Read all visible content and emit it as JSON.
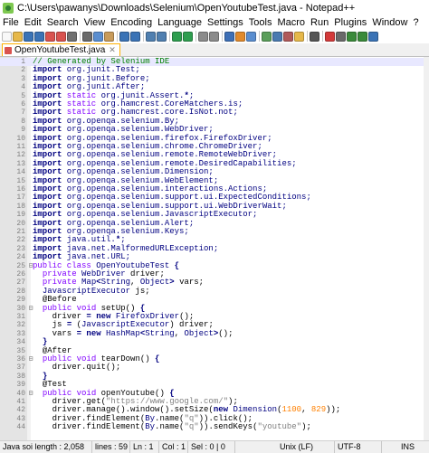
{
  "window": {
    "title": "C:\\Users\\pawanys\\Downloads\\Selenium\\OpenYoutubeTest.java - Notepad++"
  },
  "menu": [
    "File",
    "Edit",
    "Search",
    "View",
    "Encoding",
    "Language",
    "Settings",
    "Tools",
    "Macro",
    "Run",
    "Plugins",
    "Window",
    "?"
  ],
  "toolbar": {
    "buttons": [
      {
        "icon": "new-file-icon",
        "color": "#f8f8f8"
      },
      {
        "icon": "open-file-icon",
        "color": "#e6b84a"
      },
      {
        "icon": "save-icon",
        "color": "#3a73b6"
      },
      {
        "icon": "save-all-icon",
        "color": "#3a73b6"
      },
      {
        "icon": "close-icon",
        "color": "#d9534f"
      },
      {
        "icon": "close-all-icon",
        "color": "#d9534f"
      },
      {
        "icon": "print-icon",
        "color": "#707070"
      },
      {
        "sep": true
      },
      {
        "icon": "cut-icon",
        "color": "#6a6a6a"
      },
      {
        "icon": "copy-icon",
        "color": "#5a8ed0"
      },
      {
        "icon": "paste-icon",
        "color": "#c89b5a"
      },
      {
        "sep": true
      },
      {
        "icon": "undo-icon",
        "color": "#3a73b6"
      },
      {
        "icon": "redo-icon",
        "color": "#3a73b6"
      },
      {
        "sep": true
      },
      {
        "icon": "find-icon",
        "color": "#4f7fb0"
      },
      {
        "icon": "replace-icon",
        "color": "#4f7fb0"
      },
      {
        "sep": true
      },
      {
        "icon": "zoom-in-icon",
        "color": "#2e9e4f"
      },
      {
        "icon": "zoom-out-icon",
        "color": "#2e9e4f"
      },
      {
        "sep": true
      },
      {
        "icon": "sync-vertical-icon",
        "color": "#8b8b8b"
      },
      {
        "icon": "sync-horizontal-icon",
        "color": "#8b8b8b"
      },
      {
        "sep": true
      },
      {
        "icon": "word-wrap-icon",
        "color": "#3d6fb6"
      },
      {
        "icon": "show-all-chars-icon",
        "color": "#e08a2c"
      },
      {
        "icon": "indent-guide-icon",
        "color": "#5a8ed0"
      },
      {
        "sep": true
      },
      {
        "icon": "user-lang-icon",
        "color": "#5a9e5a"
      },
      {
        "icon": "doc-map-icon",
        "color": "#4a7ab0"
      },
      {
        "icon": "function-list-icon",
        "color": "#b05a5a"
      },
      {
        "icon": "folder-workspace-icon",
        "color": "#e6b84a"
      },
      {
        "sep": true
      },
      {
        "icon": "monitoring-icon",
        "color": "#555555"
      },
      {
        "sep": true
      },
      {
        "icon": "record-macro-icon",
        "color": "#d33a3a"
      },
      {
        "icon": "stop-record-icon",
        "color": "#6a6a6a"
      },
      {
        "icon": "play-macro-icon",
        "color": "#3a8a3a"
      },
      {
        "icon": "play-multiple-icon",
        "color": "#3a8a3a"
      },
      {
        "icon": "save-macro-icon",
        "color": "#3a73b6"
      }
    ]
  },
  "tab": {
    "label": "OpenYoutubeTest.java",
    "close": "✕"
  },
  "code": [
    {
      "n": "1",
      "fold": "",
      "segs": [
        [
          "cmt",
          "// Generated by Selenium IDE"
        ]
      ]
    },
    {
      "n": "2",
      "fold": "",
      "segs": [
        [
          "kw",
          "import"
        ],
        [
          "id",
          " org.junit.Test;"
        ]
      ]
    },
    {
      "n": "3",
      "fold": "",
      "segs": [
        [
          "kw",
          "import"
        ],
        [
          "id",
          " org.junit.Before;"
        ]
      ]
    },
    {
      "n": "4",
      "fold": "",
      "segs": [
        [
          "kw",
          "import"
        ],
        [
          "id",
          " org.junit.After;"
        ]
      ]
    },
    {
      "n": "5",
      "fold": "",
      "segs": [
        [
          "kw",
          "import"
        ],
        [
          "kw2",
          " static"
        ],
        [
          "id",
          " org.junit.Assert."
        ],
        [
          "op",
          "*"
        ],
        [
          "id",
          ";"
        ]
      ]
    },
    {
      "n": "6",
      "fold": "",
      "segs": [
        [
          "kw",
          "import"
        ],
        [
          "kw2",
          " static"
        ],
        [
          "id",
          " org.hamcrest.CoreMatchers.is;"
        ]
      ]
    },
    {
      "n": "7",
      "fold": "",
      "segs": [
        [
          "kw",
          "import"
        ],
        [
          "kw2",
          " static"
        ],
        [
          "id",
          " org.hamcrest.core.IsNot.not;"
        ]
      ]
    },
    {
      "n": "8",
      "fold": "",
      "segs": [
        [
          "kw",
          "import"
        ],
        [
          "id",
          " org.openqa.selenium.By;"
        ]
      ]
    },
    {
      "n": "9",
      "fold": "",
      "segs": [
        [
          "kw",
          "import"
        ],
        [
          "id",
          " org.openqa.selenium.WebDriver;"
        ]
      ]
    },
    {
      "n": "10",
      "fold": "",
      "segs": [
        [
          "kw",
          "import"
        ],
        [
          "id",
          " org.openqa.selenium.firefox.FirefoxDriver;"
        ]
      ]
    },
    {
      "n": "11",
      "fold": "",
      "segs": [
        [
          "kw",
          "import"
        ],
        [
          "id",
          " org.openqa.selenium.chrome.ChromeDriver;"
        ]
      ]
    },
    {
      "n": "12",
      "fold": "",
      "segs": [
        [
          "kw",
          "import"
        ],
        [
          "id",
          " org.openqa.selenium.remote.RemoteWebDriver;"
        ]
      ]
    },
    {
      "n": "13",
      "fold": "",
      "segs": [
        [
          "kw",
          "import"
        ],
        [
          "id",
          " org.openqa.selenium.remote.DesiredCapabilities;"
        ]
      ]
    },
    {
      "n": "14",
      "fold": "",
      "segs": [
        [
          "kw",
          "import"
        ],
        [
          "id",
          " org.openqa.selenium.Dimension;"
        ]
      ]
    },
    {
      "n": "15",
      "fold": "",
      "segs": [
        [
          "kw",
          "import"
        ],
        [
          "id",
          " org.openqa.selenium.WebElement;"
        ]
      ]
    },
    {
      "n": "16",
      "fold": "",
      "segs": [
        [
          "kw",
          "import"
        ],
        [
          "id",
          " org.openqa.selenium.interactions.Actions;"
        ]
      ]
    },
    {
      "n": "17",
      "fold": "",
      "segs": [
        [
          "kw",
          "import"
        ],
        [
          "id",
          " org.openqa.selenium.support.ui.ExpectedConditions;"
        ]
      ]
    },
    {
      "n": "18",
      "fold": "",
      "segs": [
        [
          "kw",
          "import"
        ],
        [
          "id",
          " org.openqa.selenium.support.ui.WebDriverWait;"
        ]
      ]
    },
    {
      "n": "19",
      "fold": "",
      "segs": [
        [
          "kw",
          "import"
        ],
        [
          "id",
          " org.openqa.selenium.JavascriptExecutor;"
        ]
      ]
    },
    {
      "n": "20",
      "fold": "",
      "segs": [
        [
          "kw",
          "import"
        ],
        [
          "id",
          " org.openqa.selenium.Alert;"
        ]
      ]
    },
    {
      "n": "21",
      "fold": "",
      "segs": [
        [
          "kw",
          "import"
        ],
        [
          "id",
          " org.openqa.selenium.Keys;"
        ]
      ]
    },
    {
      "n": "22",
      "fold": "",
      "segs": [
        [
          "kw",
          "import"
        ],
        [
          "id",
          " java.util."
        ],
        [
          "op",
          "*"
        ],
        [
          "id",
          ";"
        ]
      ]
    },
    {
      "n": "23",
      "fold": "",
      "segs": [
        [
          "kw",
          "import"
        ],
        [
          "id",
          " java.net.MalformedURLException;"
        ]
      ]
    },
    {
      "n": "24",
      "fold": "",
      "segs": [
        [
          "kw",
          "import"
        ],
        [
          "id",
          " java.net.URL;"
        ]
      ]
    },
    {
      "n": "25",
      "fold": "⊟",
      "segs": [
        [
          "kw2",
          "public"
        ],
        [
          "kw2",
          " class"
        ],
        [
          "cls",
          " OpenYoutubeTest "
        ],
        [
          "op",
          "{"
        ]
      ]
    },
    {
      "n": "26",
      "fold": "",
      "segs": [
        [
          "plain",
          "  "
        ],
        [
          "kw2",
          "private"
        ],
        [
          "cls",
          " WebDriver"
        ],
        [
          "plain",
          " driver;"
        ]
      ]
    },
    {
      "n": "27",
      "fold": "",
      "segs": [
        [
          "plain",
          "  "
        ],
        [
          "kw2",
          "private"
        ],
        [
          "cls",
          " Map"
        ],
        [
          "op",
          "<"
        ],
        [
          "cls",
          "String"
        ],
        [
          "plain",
          ", "
        ],
        [
          "cls",
          "Object"
        ],
        [
          "op",
          ">"
        ],
        [
          "plain",
          " vars;"
        ]
      ]
    },
    {
      "n": "28",
      "fold": "",
      "segs": [
        [
          "plain",
          "  "
        ],
        [
          "cls",
          "JavascriptExecutor"
        ],
        [
          "plain",
          " js;"
        ]
      ]
    },
    {
      "n": "29",
      "fold": "",
      "segs": [
        [
          "plain",
          "  "
        ],
        [
          "anno",
          "@Before"
        ]
      ]
    },
    {
      "n": "30",
      "fold": "⊟",
      "segs": [
        [
          "plain",
          "  "
        ],
        [
          "kw2",
          "public"
        ],
        [
          "kw2",
          " void"
        ],
        [
          "plain",
          " setUp() "
        ],
        [
          "op",
          "{"
        ]
      ]
    },
    {
      "n": "31",
      "fold": "",
      "segs": [
        [
          "plain",
          "    driver "
        ],
        [
          "op",
          "="
        ],
        [
          "kw",
          " new"
        ],
        [
          "cls",
          " FirefoxDriver"
        ],
        [
          "plain",
          "();"
        ]
      ]
    },
    {
      "n": "32",
      "fold": "",
      "segs": [
        [
          "plain",
          "    js "
        ],
        [
          "op",
          "="
        ],
        [
          "plain",
          " ("
        ],
        [
          "cls",
          "JavascriptExecutor"
        ],
        [
          "plain",
          ") driver;"
        ]
      ]
    },
    {
      "n": "33",
      "fold": "",
      "segs": [
        [
          "plain",
          "    vars "
        ],
        [
          "op",
          "="
        ],
        [
          "kw",
          " new"
        ],
        [
          "cls",
          " HashMap"
        ],
        [
          "op",
          "<"
        ],
        [
          "cls",
          "String"
        ],
        [
          "plain",
          ", "
        ],
        [
          "cls",
          "Object"
        ],
        [
          "op",
          ">"
        ],
        [
          "plain",
          "();"
        ]
      ]
    },
    {
      "n": "34",
      "fold": "",
      "segs": [
        [
          "plain",
          "  "
        ],
        [
          "op",
          "}"
        ]
      ]
    },
    {
      "n": "35",
      "fold": "",
      "segs": [
        [
          "plain",
          "  "
        ],
        [
          "anno",
          "@After"
        ]
      ]
    },
    {
      "n": "36",
      "fold": "⊟",
      "segs": [
        [
          "plain",
          "  "
        ],
        [
          "kw2",
          "public"
        ],
        [
          "kw2",
          " void"
        ],
        [
          "plain",
          " tearDown() "
        ],
        [
          "op",
          "{"
        ]
      ]
    },
    {
      "n": "37",
      "fold": "",
      "segs": [
        [
          "plain",
          "    driver.quit();"
        ]
      ]
    },
    {
      "n": "38",
      "fold": "",
      "segs": [
        [
          "plain",
          "  "
        ],
        [
          "op",
          "}"
        ]
      ]
    },
    {
      "n": "39",
      "fold": "",
      "segs": [
        [
          "plain",
          "  "
        ],
        [
          "anno",
          "@Test"
        ]
      ]
    },
    {
      "n": "40",
      "fold": "⊟",
      "segs": [
        [
          "plain",
          "  "
        ],
        [
          "kw2",
          "public"
        ],
        [
          "kw2",
          " void"
        ],
        [
          "plain",
          " openYoutube() "
        ],
        [
          "op",
          "{"
        ]
      ]
    },
    {
      "n": "41",
      "fold": "",
      "segs": [
        [
          "plain",
          "    driver.get("
        ],
        [
          "str",
          "\"https://www.google.com/\""
        ],
        [
          "plain",
          ");"
        ]
      ]
    },
    {
      "n": "42",
      "fold": "",
      "segs": [
        [
          "plain",
          "    driver.manage().window().setSize("
        ],
        [
          "kw",
          "new"
        ],
        [
          "cls",
          " Dimension"
        ],
        [
          "plain",
          "("
        ],
        [
          "num",
          "1100"
        ],
        [
          "plain",
          ", "
        ],
        [
          "num",
          "829"
        ],
        [
          "plain",
          "));"
        ]
      ]
    },
    {
      "n": "43",
      "fold": "",
      "segs": [
        [
          "plain",
          "    driver.findElement("
        ],
        [
          "cls",
          "By"
        ],
        [
          "plain",
          ".name("
        ],
        [
          "str",
          "\"q\""
        ],
        [
          "plain",
          ")).click();"
        ]
      ]
    },
    {
      "n": "44",
      "fold": "",
      "segs": [
        [
          "plain",
          "    driver.findElement("
        ],
        [
          "cls",
          "By"
        ],
        [
          "plain",
          ".name("
        ],
        [
          "str",
          "\"q\""
        ],
        [
          "plain",
          ")).sendKeys("
        ],
        [
          "str",
          "\"youtube\""
        ],
        [
          "plain",
          ");"
        ]
      ]
    }
  ],
  "status": {
    "length": "Java soi length : 2,058",
    "lines": "lines : 59",
    "ln": "Ln : 1",
    "col": "Col : 1",
    "sel": "Sel : 0 | 0",
    "eol": "Unix (LF)",
    "encoding": "UTF-8",
    "mode": "INS"
  },
  "colors": {
    "keyword": "#000080",
    "type_keyword": "#8000ff",
    "comment": "#008000",
    "string": "#808080",
    "number": "#ff8000",
    "current_line": "#e8e8ff",
    "tab_border": "#ffb000"
  }
}
